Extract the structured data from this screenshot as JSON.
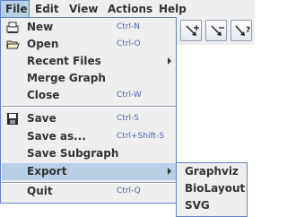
{
  "menubar": {
    "items": [
      {
        "label": "File",
        "active": true
      },
      {
        "label": "Edit",
        "active": false
      },
      {
        "label": "View",
        "active": false
      },
      {
        "label": "Actions",
        "active": false
      },
      {
        "label": "Help",
        "active": false
      }
    ]
  },
  "toolbar": {
    "buttons": [
      {
        "icon": "add-edge-icon"
      },
      {
        "icon": "remove-edge-icon"
      },
      {
        "icon": "query-edge-icon"
      }
    ]
  },
  "file_menu": {
    "items": [
      {
        "label": "New",
        "accelerator": "Ctrl-N",
        "icon": "new-file-icon"
      },
      {
        "label": "Open",
        "accelerator": "Ctrl-O",
        "icon": "open-folder-icon"
      },
      {
        "label": "Recent Files",
        "submenu": true
      },
      {
        "label": "Merge Graph"
      },
      {
        "label": "Close",
        "accelerator": "Ctrl-W"
      },
      {
        "label": "Save",
        "accelerator": "Ctrl-S",
        "icon": "save-disk-icon"
      },
      {
        "label": "Save as...",
        "accelerator": "Ctrl+Shift-S"
      },
      {
        "label": "Save Subgraph"
      },
      {
        "label": "Export",
        "submenu": true,
        "highlighted": true
      },
      {
        "label": "Quit",
        "accelerator": "Ctrl-Q"
      }
    ]
  },
  "export_submenu": {
    "items": [
      {
        "label": "Graphviz"
      },
      {
        "label": "BioLayout"
      },
      {
        "label": "SVG"
      }
    ]
  },
  "colors": {
    "menu_bg": "#eeeeee",
    "selection": "#b8cfe5",
    "border": "#6382bf",
    "accelerator_text": "#4e6aa8"
  }
}
